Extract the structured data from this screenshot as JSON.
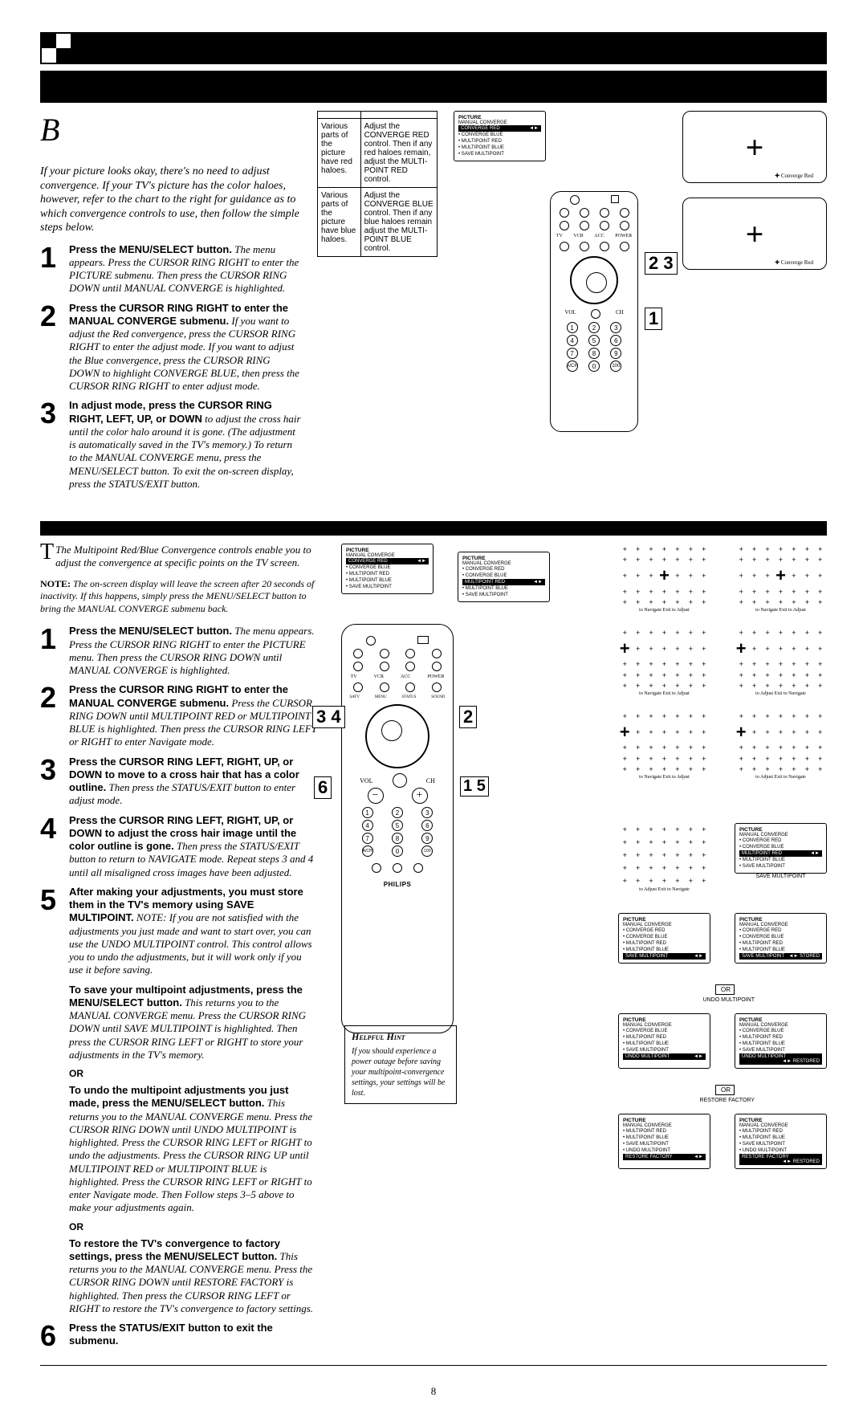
{
  "header": {
    "decor_letter": "B"
  },
  "basic": {
    "intro": "If your picture looks okay, there's no need to adjust convergence. If your TV's picture has the color haloes, however, refer to the chart to the right for guidance as to which convergence controls to use, then follow the simple steps below.",
    "steps": [
      {
        "n": "1",
        "bold": "Press the MENU/SELECT button.",
        "rest": " The menu appears. Press the CURSOR RING RIGHT to enter the PICTURE submenu. Then press the CURSOR RING DOWN until MANUAL CONVERGE is highlighted."
      },
      {
        "n": "2",
        "bold": "Press the CURSOR RING RIGHT to enter the MANUAL CONVERGE submenu.",
        "rest": " If you want to adjust the Red convergence, press the CURSOR RING RIGHT to enter the adjust mode. If you want to adjust the Blue convergence, press the CURSOR RING DOWN to highlight CONVERGE BLUE, then press the CURSOR RING RIGHT to enter adjust mode."
      },
      {
        "n": "3",
        "bold": "In adjust mode, press the CURSOR RING RIGHT, LEFT, UP, or DOWN",
        "rest": " to adjust the cross hair until the color halo around it is gone. (The adjustment is automatically saved in the TV's memory.) To return to the MANUAL CONVERGE menu, press the MENU/SELECT button. To exit the on-screen display, press the STATUS/EXIT button."
      }
    ],
    "table": {
      "headers": [
        "",
        ""
      ],
      "rows": [
        {
          "symptom": "Various parts of the picture have red haloes.",
          "action": "Adjust the CONVERGE RED control. Then if any red haloes remain, adjust the MULTI-POINT RED control."
        },
        {
          "symptom": "Various parts of the picture have blue haloes.",
          "action": "Adjust the CONVERGE BLUE control. Then if any blue haloes remain adjust the MULTI-POINT BLUE control."
        }
      ]
    },
    "tv_caption": "Converge Red",
    "remote_numbers": [
      "1",
      "2",
      "3"
    ],
    "menu": {
      "title": "PICTURE",
      "subtitle": "MANUAL CONVERGE",
      "items": [
        "CONVERGE RED",
        "CONVERGE BLUE",
        "MULTIPOINT RED",
        "MULTIPOINT BLUE",
        "SAVE MULTIPOINT"
      ],
      "sel_index": 0
    }
  },
  "multipoint": {
    "intro": "The Multipoint Red/Blue Convergence controls enable you to adjust the convergence at specific points on the TV screen.",
    "note": "NOTE: The on-screen display will leave the screen after 20 seconds of inactivity. If this happens, simply press the MENU/SELECT button to bring the MANUAL CONVERGE submenu back.",
    "steps": [
      {
        "n": "1",
        "bold": "Press the MENU/SELECT button.",
        "rest": " The menu appears. Press the CURSOR RING RIGHT to enter the PICTURE menu. Then press the CURSOR RING DOWN until MANUAL CONVERGE is highlighted."
      },
      {
        "n": "2",
        "bold": "Press the CURSOR RING RIGHT to enter the MANUAL CONVERGE submenu.",
        "rest": " Press the CURSOR RING DOWN until MULTIPOINT RED or MULTIPOINT BLUE is highlighted. Then press the CURSOR RING LEFT or RIGHT to enter Navigate mode."
      },
      {
        "n": "3",
        "bold": "Press the CURSOR RING LEFT, RIGHT, UP, or DOWN to move to a cross hair that has a color outline.",
        "rest": " Then press the STATUS/EXIT button to enter adjust mode."
      },
      {
        "n": "4",
        "bold": "Press the CURSOR RING LEFT, RIGHT, UP, or DOWN to adjust the cross hair image until the color outline is gone.",
        "rest": " Then press the STATUS/EXIT button to return to NAVIGATE mode. Repeat steps 3 and 4 until all misaligned cross images have been adjusted."
      },
      {
        "n": "5",
        "bold": "After making your adjustments, you must store them in the TV's memory using SAVE MULTIPOINT.",
        "rest": " NOTE: If you are not satisfied with the adjustments you just made and want to start over, you can use the UNDO MULTIPOINT control. This control allows you to undo the adjustments, but it will work only if you use it before saving."
      }
    ],
    "save_para": {
      "bold": "To save your multipoint adjustments, press the MENU/SELECT button.",
      "rest": " This returns you to the MANUAL CONVERGE menu. Press the CURSOR RING DOWN until SAVE MULTIPOINT is highlighted. Then press the CURSOR RING LEFT or RIGHT to store your adjustments in the TV's memory."
    },
    "or": "OR",
    "undo_para": {
      "bold": "To undo the multipoint adjustments you just made, press the MENU/SELECT button.",
      "rest": " This returns you to the MANUAL CONVERGE menu. Press the CURSOR RING DOWN until UNDO MULTIPOINT is highlighted. Press the CURSOR RING LEFT or RIGHT to undo the adjustments. Press the CURSOR RING UP until MULTIPOINT RED or MULTIPOINT BLUE is highlighted. Press the CURSOR RING LEFT or RIGHT to enter Navigate mode. Then Follow steps 3–5 above to make your adjustments again."
    },
    "restore_para": {
      "bold": "To restore the TV's convergence to factory settings, press the MENU/SELECT button.",
      "rest": " This returns you to the MANUAL CONVERGE menu. Press the CURSOR RING DOWN until RESTORE FACTORY is highlighted. Then press the CURSOR RING LEFT or RIGHT to restore the TV's convergence to factory settings."
    },
    "step6": {
      "n": "6",
      "bold": "Press the STATUS/EXIT button to exit the submenu.",
      "rest": ""
    },
    "remote_numbers": [
      "2",
      "3",
      "4",
      "6",
      "1",
      "5"
    ],
    "remote_brand": "PHILIPS",
    "hint": {
      "title": "Helpful Hint",
      "body": "If you should experience a power outage before saving your multipoint-convergence settings, your settings will be lost."
    },
    "grid_caps": {
      "nav": "to Navigate  Exit to Adjust",
      "adj": "to Adjust  Exit to Navigate"
    },
    "action_labels": {
      "save": "SAVE MULTIPOINT",
      "undo": "UNDO MULTIPOINT",
      "restore": "RESTORE FACTORY",
      "stored": "STORED",
      "restored": "RESTORED"
    },
    "menus": [
      {
        "title": "PICTURE",
        "subtitle": "MANUAL CONVERGE",
        "items": [
          "CONVERGE RED",
          "CONVERGE BLUE",
          "MULTIPOINT RED",
          "MULTIPOINT BLUE",
          "SAVE MULTIPOINT"
        ],
        "sel": 0
      },
      {
        "title": "PICTURE",
        "subtitle": "MANUAL CONVERGE",
        "items": [
          "CONVERGE RED",
          "CONVERGE BLUE",
          "MULTIPOINT RED",
          "MULTIPOINT BLUE",
          "SAVE MULTIPOINT"
        ],
        "sel": 2
      },
      {
        "title": "PICTURE",
        "subtitle": "MANUAL CONVERGE",
        "items": [
          "CONVERGE RED",
          "CONVERGE BLUE",
          "MULTIPOINT RED",
          "MULTIPOINT BLUE",
          "SAVE MULTIPOINT"
        ],
        "sel": 4
      },
      {
        "title": "PICTURE",
        "subtitle": "MANUAL CONVERGE",
        "items": [
          "CONVERGE BLUE",
          "MULTIPOINT RED",
          "MULTIPOINT BLUE",
          "SAVE MULTIPOINT",
          "UNDO MULTIPOINT"
        ],
        "sel": 4
      },
      {
        "title": "PICTURE",
        "subtitle": "MANUAL CONVERGE",
        "items": [
          "MULTIPOINT RED",
          "MULTIPOINT BLUE",
          "SAVE MULTIPOINT",
          "UNDO MULTIPOINT",
          "RESTORE FACTORY"
        ],
        "sel": 4
      }
    ]
  },
  "page_number": "8"
}
